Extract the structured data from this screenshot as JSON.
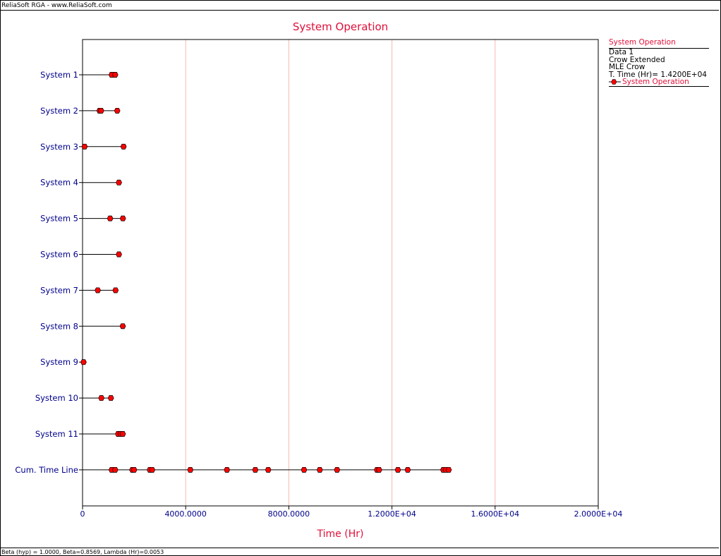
{
  "window": {
    "title": "ReliaSoft RGA - www.ReliaSoft.com",
    "status": "Beta (hyp) = 1.0000, Beta=0.8569, Lambda (Hr)=0.0053"
  },
  "legend": {
    "title": "System Operation",
    "lines": [
      "Data 1",
      "Crow Extended",
      "MLE Crow",
      "T. Time (Hr)= 1.4200E+04"
    ],
    "series_label": "System Operation"
  },
  "colors": {
    "title": "#e0103a",
    "axis_label": "#00008b",
    "marker_fill": "#ff0000",
    "grid": "#f4b8b0"
  },
  "chart_data": {
    "type": "scatter",
    "title": "System Operation",
    "xlabel": "Time (Hr)",
    "ylabel": "",
    "xlim": [
      0,
      20000
    ],
    "x_ticks": [
      0,
      4000,
      8000,
      12000,
      16000,
      20000
    ],
    "x_tick_labels": [
      "0",
      "4000.0000",
      "8000.0000",
      "1.2000E+04",
      "1.6000E+04",
      "2.0000E+04"
    ],
    "grid": "vertical",
    "legend_position": "right",
    "rows": [
      {
        "label": "System 1",
        "end": 1265,
        "failures": [
          1130,
          1265
        ]
      },
      {
        "label": "System 2",
        "end": 1345,
        "failures": [
          660,
          720,
          1345
        ]
      },
      {
        "label": "System 3",
        "end": 1590,
        "failures": [
          80,
          1590
        ]
      },
      {
        "label": "System 4",
        "end": 1410,
        "failures": [
          1410
        ]
      },
      {
        "label": "System 5",
        "end": 1565,
        "failures": [
          1070,
          1565
        ]
      },
      {
        "label": "System 6",
        "end": 1410,
        "failures": [
          1410
        ]
      },
      {
        "label": "System 7",
        "end": 1280,
        "failures": [
          590,
          1280
        ]
      },
      {
        "label": "System 8",
        "end": 1560,
        "failures": [
          1560
        ]
      },
      {
        "label": "System 9",
        "end": 40,
        "failures": [
          40
        ]
      },
      {
        "label": "System 10",
        "end": 1100,
        "failures": [
          730,
          1100
        ]
      },
      {
        "label": "System 11",
        "end": 1560,
        "failures": [
          1380,
          1480,
          1560
        ]
      },
      {
        "label": "Cum. Time Line",
        "end": 14200,
        "failures": [
          1130,
          1265,
          1930,
          2000,
          2610,
          2700,
          4180,
          5600,
          6700,
          7200,
          8590,
          9200,
          9870,
          11420,
          11500,
          12230,
          12610,
          13990,
          14090,
          14200
        ]
      }
    ]
  }
}
